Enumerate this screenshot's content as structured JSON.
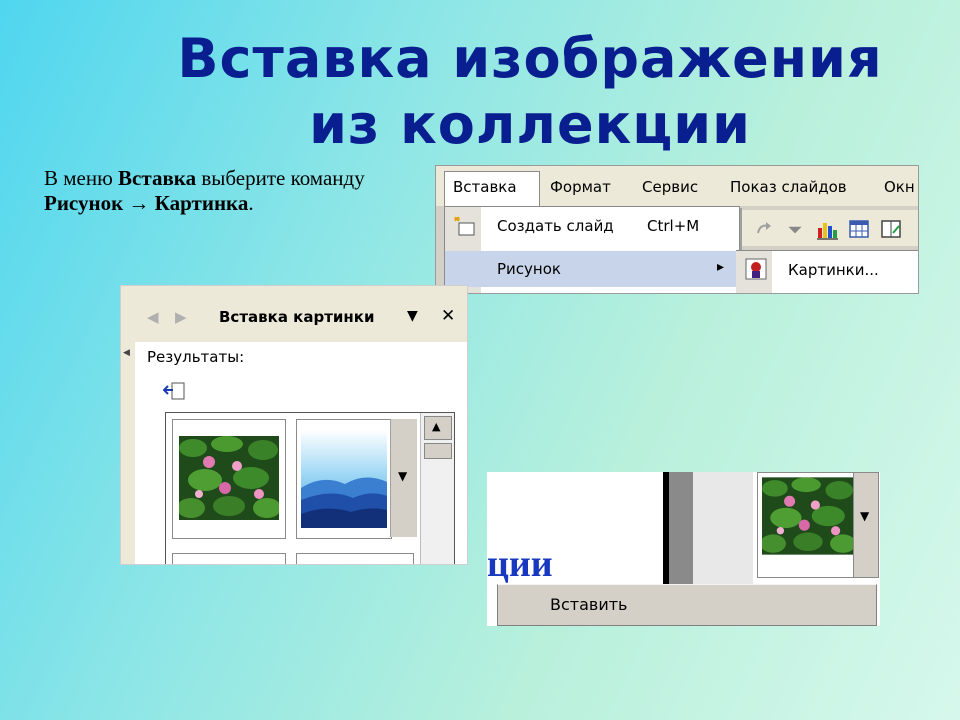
{
  "slide": {
    "title": "Вставка изображения из коллекции",
    "instruction": {
      "prefix": "В меню ",
      "menu": "Вставка",
      "middle": " выберите команду ",
      "command": "Рисунок → Картинка",
      "suffix": "."
    }
  },
  "menu_screenshot": {
    "menubar": [
      "Вставка",
      "Формат",
      "Сервис",
      "Показ слайдов",
      "Окн"
    ],
    "dropdown": [
      {
        "label": "Создать слайд",
        "shortcut": "Ctrl+M"
      },
      {
        "label": "Рисунок",
        "arrow": "▸"
      }
    ],
    "submenu": {
      "label": "Картинки..."
    },
    "toolbar_icons": [
      "redo-icon",
      "chart-icon",
      "table-icon",
      "columns-icon"
    ]
  },
  "task_pane": {
    "title": "Вставка картинки",
    "nav": {
      "back": "◀",
      "forward": "▶"
    },
    "menu_arrow": "▼",
    "close": "✕",
    "results_label": "Результаты:",
    "thumbnails": [
      "water-lilies",
      "blue-mountains"
    ]
  },
  "insert_screenshot": {
    "partial_text": "ции",
    "context_item": "Вставить",
    "dropdown_arrow": "▼"
  },
  "colors": {
    "title": "#0a1f8f",
    "bg_start": "#4fd6ef",
    "bg_end": "#d6f8ec",
    "menu_highlight": "#c8d4ea",
    "partial_text": "#1838c0"
  }
}
